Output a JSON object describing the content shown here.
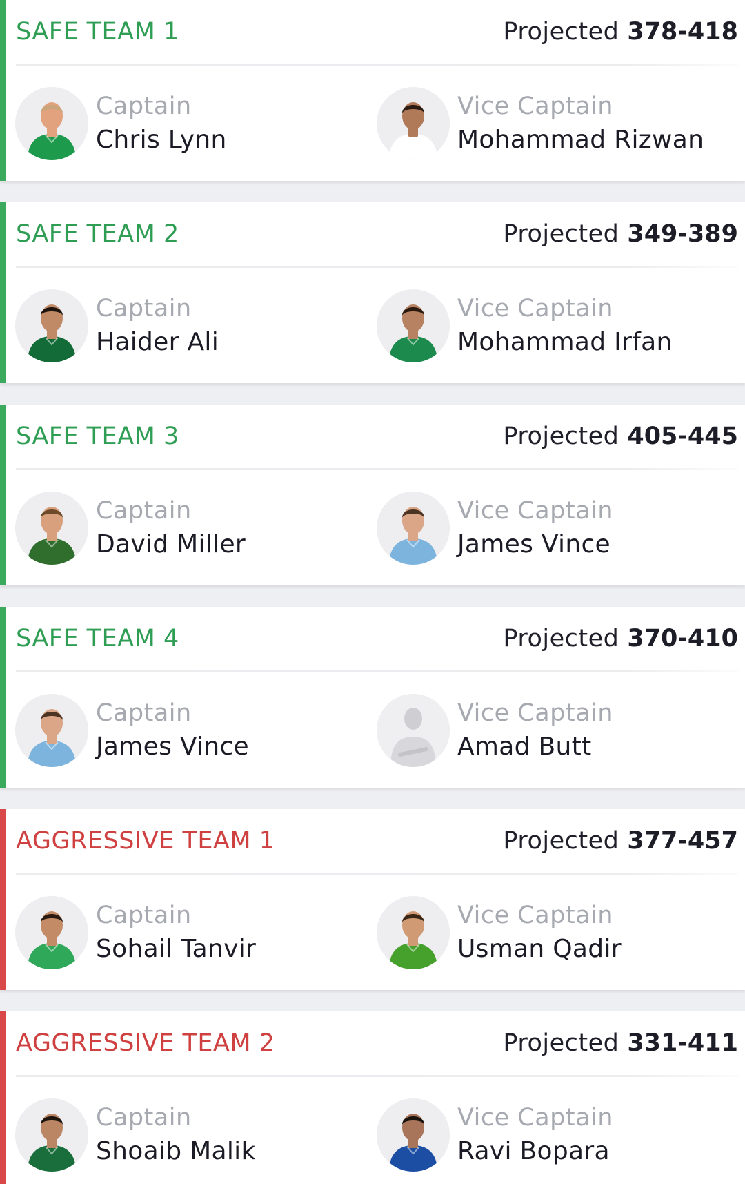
{
  "colors": {
    "safe_accent": "#3caa5c",
    "aggressive_accent": "#d9494a",
    "background": "#eeeff3"
  },
  "teams": [
    {
      "type": "safe",
      "name": "SAFE TEAM 1",
      "projected_label": "Projected",
      "projected_range": "378-418",
      "captain": {
        "role": "Captain",
        "name": "Chris Lynn",
        "shirt": "#1e9a4c",
        "skin": "#e2a27e",
        "hair": "#c8a57a"
      },
      "vice_captain": {
        "role": "Vice Captain",
        "name": "Mohammad Rizwan",
        "shirt": "#ffffff",
        "skin": "#b07a58",
        "hair": "#2a1b14"
      }
    },
    {
      "type": "safe",
      "name": "SAFE TEAM 2",
      "projected_label": "Projected",
      "projected_range": "349-389",
      "captain": {
        "role": "Captain",
        "name": "Haider Ali",
        "shirt": "#136b38",
        "skin": "#c08a66",
        "hair": "#1e140e"
      },
      "vice_captain": {
        "role": "Vice Captain",
        "name": "Mohammad Irfan",
        "shirt": "#1c8a4c",
        "skin": "#b68262",
        "hair": "#2a1a10"
      }
    },
    {
      "type": "safe",
      "name": "SAFE TEAM 3",
      "projected_label": "Projected",
      "projected_range": "405-445",
      "captain": {
        "role": "Captain",
        "name": "David Miller",
        "shirt": "#2f6e2c",
        "skin": "#d8a07c",
        "hair": "#6c4a2a"
      },
      "vice_captain": {
        "role": "Vice Captain",
        "name": "James Vince",
        "shirt": "#7db4de",
        "skin": "#dba587",
        "hair": "#4c3424"
      }
    },
    {
      "type": "safe",
      "name": "SAFE TEAM 4",
      "projected_label": "Projected",
      "projected_range": "370-410",
      "captain": {
        "role": "Captain",
        "name": "James Vince",
        "shirt": "#7db4de",
        "skin": "#dba587",
        "hair": "#4c3424"
      },
      "vice_captain": {
        "role": "Vice Captain",
        "name": "Amad Butt",
        "shirt": "#d6d6da",
        "skin": "#c9c9cd",
        "hair": "#c9c9cd"
      }
    },
    {
      "type": "aggressive",
      "name": "AGGRESSIVE TEAM 1",
      "projected_label": "Projected",
      "projected_range": "377-457",
      "captain": {
        "role": "Captain",
        "name": "Sohail Tanvir",
        "shirt": "#2fa85a",
        "skin": "#c48c66",
        "hair": "#2a1a12"
      },
      "vice_captain": {
        "role": "Vice Captain",
        "name": "Usman Qadir",
        "shirt": "#46a02c",
        "skin": "#cf9a74",
        "hair": "#3b2716"
      }
    },
    {
      "type": "aggressive",
      "name": "AGGRESSIVE TEAM 2",
      "projected_label": "Projected",
      "projected_range": "331-411",
      "captain": {
        "role": "Captain",
        "name": "Shoaib Malik",
        "shirt": "#1a6e3c",
        "skin": "#bb8664",
        "hair": "#1e140e"
      },
      "vice_captain": {
        "role": "Vice Captain",
        "name": "Ravi Bopara",
        "shirt": "#1c4fa3",
        "skin": "#a8745a",
        "hair": "#1a120c"
      }
    }
  ]
}
